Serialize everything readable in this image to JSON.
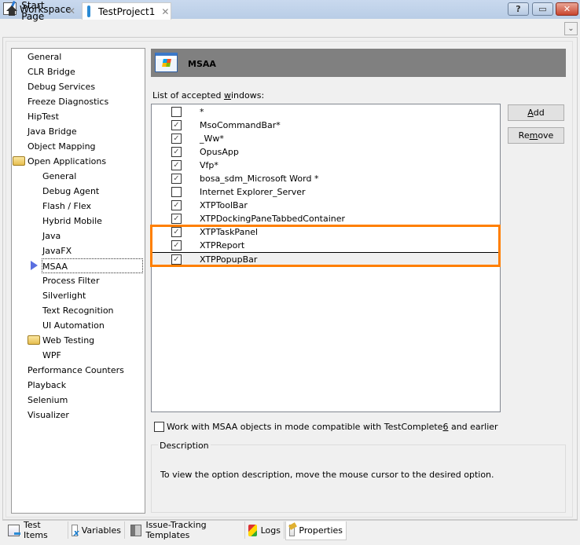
{
  "window": {
    "title": "Workspace",
    "buttons": {
      "help": "?",
      "restore": "▭",
      "close": "✕"
    }
  },
  "doc_tabs": [
    {
      "label": "Start Page",
      "icon": "home-icon",
      "active": false,
      "close": "✕"
    },
    {
      "label": "TestProject1",
      "icon": "project-icon",
      "active": true,
      "close": "✕"
    }
  ],
  "tab_menu_glyph": "⌄",
  "tree": {
    "items": [
      {
        "label": "General",
        "level": 0
      },
      {
        "label": "CLR Bridge",
        "level": 0
      },
      {
        "label": "Debug Services",
        "level": 0
      },
      {
        "label": "Freeze Diagnostics",
        "level": 0
      },
      {
        "label": "HipTest",
        "level": 0
      },
      {
        "label": "Java Bridge",
        "level": 0
      },
      {
        "label": "Object Mapping",
        "level": 0
      },
      {
        "label": "Open Applications",
        "level": 0,
        "folder": true
      },
      {
        "label": "General",
        "level": 1
      },
      {
        "label": "Debug Agent",
        "level": 1
      },
      {
        "label": "Flash / Flex",
        "level": 1
      },
      {
        "label": "Hybrid Mobile",
        "level": 1
      },
      {
        "label": "Java",
        "level": 1
      },
      {
        "label": "JavaFX",
        "level": 1
      },
      {
        "label": "MSAA",
        "level": 1,
        "selected": true
      },
      {
        "label": "Process Filter",
        "level": 1
      },
      {
        "label": "Silverlight",
        "level": 1
      },
      {
        "label": "Text Recognition",
        "level": 1
      },
      {
        "label": "UI Automation",
        "level": 1
      },
      {
        "label": "Web Testing",
        "level": 1,
        "folder": true
      },
      {
        "label": "WPF",
        "level": 1
      },
      {
        "label": "Performance Counters",
        "level": 0
      },
      {
        "label": "Playback",
        "level": 0
      },
      {
        "label": "Selenium",
        "level": 0
      },
      {
        "label": "Visualizer",
        "level": 0
      }
    ]
  },
  "panel": {
    "title": "MSAA",
    "list_label_pre": "List of accepted ",
    "list_label_u": "w",
    "list_label_post": "indows:",
    "windows": [
      {
        "name": "*",
        "checked": false
      },
      {
        "name": "MsoCommandBar*",
        "checked": true
      },
      {
        "name": "_Ww*",
        "checked": true
      },
      {
        "name": "OpusApp",
        "checked": true
      },
      {
        "name": "Vfp*",
        "checked": true
      },
      {
        "name": "bosa_sdm_Microsoft Word *",
        "checked": true
      },
      {
        "name": "Internet Explorer_Server",
        "checked": false
      },
      {
        "name": "XTPToolBar",
        "checked": true
      },
      {
        "name": "XTPDockingPaneTabbedContainer",
        "checked": true
      },
      {
        "name": "XTPTaskPanel",
        "checked": true
      },
      {
        "name": "XTPReport",
        "checked": true
      },
      {
        "name": "XTPPopupBar",
        "checked": true,
        "focused": true
      }
    ],
    "add_button": {
      "u": "A",
      "rest": "dd"
    },
    "remove_button": {
      "pre": "Re",
      "u": "m",
      "rest": "ove"
    },
    "compat_option": {
      "pre": "Work with MSAA objects in mode compatible with TestComplete ",
      "u": "6",
      "post": " and earlier",
      "checked": false
    },
    "description": {
      "legend": "Description",
      "text": "To view the option description, move the mouse cursor to the desired option."
    },
    "highlight_color": "#ff7f00"
  },
  "bottom_tabs": [
    {
      "label": "Test Items",
      "icon": "test-items-icon",
      "active": false
    },
    {
      "label": "Variables",
      "icon": "variables-icon",
      "active": false
    },
    {
      "label": "Issue-Tracking Templates",
      "icon": "issue-tracking-icon",
      "active": false
    },
    {
      "label": "Logs",
      "icon": "logs-icon",
      "active": false
    },
    {
      "label": "Properties",
      "icon": "properties-icon",
      "active": true
    }
  ],
  "check_glyph": "✓"
}
